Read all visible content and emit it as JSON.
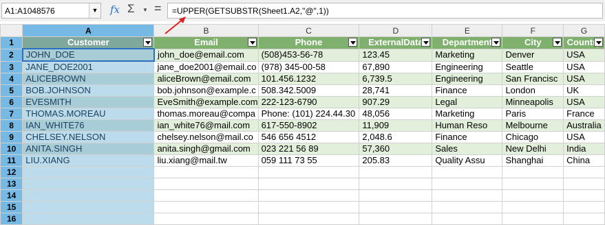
{
  "formula_bar": {
    "name_box": "A1:A1048576",
    "fx_label": "fx",
    "sigma_label": "Σ",
    "equals_label": "=",
    "formula": "=UPPER(GETSUBSTR(Sheet1.A2,\"@\",1))"
  },
  "columns": [
    "A",
    "B",
    "C",
    "D",
    "E",
    "F",
    "G"
  ],
  "row_numbers": [
    "1",
    "2",
    "3",
    "4",
    "5",
    "6",
    "7",
    "8",
    "9",
    "10",
    "11",
    "12",
    "13",
    "14",
    "15",
    "16"
  ],
  "headers": [
    "Customer",
    "Email",
    "Phone",
    "ExternalData",
    "Department",
    "City",
    "Country"
  ],
  "rows": [
    [
      "JOHN_DOE",
      "john_doe@email.com",
      "(508)453-56-78",
      "123.45",
      "Marketing",
      "Denver",
      "USA"
    ],
    [
      "JANE_DOE2001",
      "jane_doe2001@email.co",
      "(978) 345-00-58",
      "67,890",
      "Engineering",
      "Seattle",
      "USA"
    ],
    [
      "ALICEBROWN",
      "aliceBrown@email.com",
      "101.456.1232",
      "6,739.5",
      "Engineering",
      "San Francisc",
      "USA"
    ],
    [
      "BOB.JOHNSON",
      "bob.johnson@example.c",
      "508.342.5009",
      "28,741",
      "Finance",
      "London",
      "UK"
    ],
    [
      "EVESMITH",
      "EveSmith@example.com",
      "222-123-6790",
      "907.29",
      "Legal",
      "Minneapolis",
      "USA"
    ],
    [
      "THOMAS.MOREAU",
      "thomas.moreau@compa",
      "Phone: (101) 224.44.30",
      "48,056",
      "Marketing",
      "Paris",
      "France"
    ],
    [
      "IAN_WHITE76",
      "ian_white76@mail.com",
      "617-550-8902",
      "11,909",
      "Human Reso",
      "Melbourne",
      "Australia"
    ],
    [
      "CHELSEY.NELSON",
      "chelsey.nelson@mail.co",
      "546 656 4512",
      "2,048.6",
      "Finance",
      "Chicago",
      "USA"
    ],
    [
      "ANITA.SINGH",
      "anita.singh@gmail.com",
      "023 221 56 89",
      "57,360",
      "Sales",
      "New Delhi",
      "India"
    ],
    [
      "LIU.XIANG",
      "liu.xiang@mail.tw",
      "059 111 73 55",
      "205.83",
      "Quality Assu",
      "Shanghai",
      "China"
    ]
  ],
  "colors": {
    "header_green": "#7fb06d",
    "band_green": "#e2efda",
    "selection_blue": "#bcdceb",
    "arrow_red": "#e02020"
  }
}
